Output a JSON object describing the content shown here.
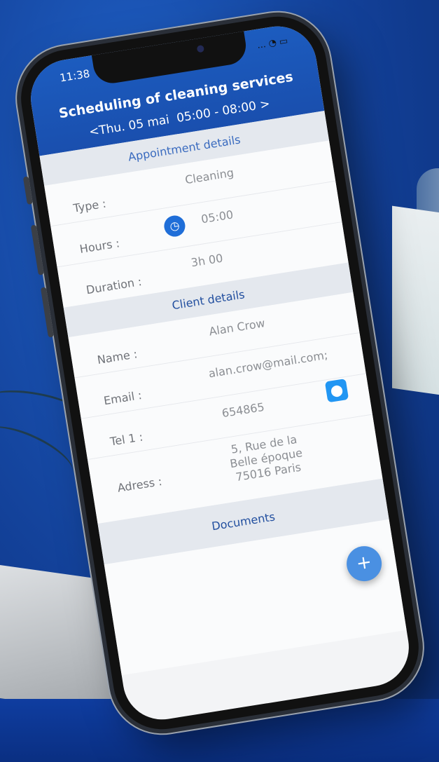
{
  "status_bar": {
    "time": "11:38",
    "signal": "...",
    "battery": "battery-icon"
  },
  "header": {
    "title": "Scheduling of cleaning services",
    "prev": "<",
    "date": "Thu. 05 mai",
    "time_range": "05:00 - 08:00",
    "next": ">"
  },
  "appointment": {
    "section_title": "Appointment details",
    "type_label": "Type :",
    "type_value": "Cleaning",
    "hours_label": "Hours :",
    "hours_value": "05:00",
    "duration_label": "Duration :",
    "duration_value": "3h 00"
  },
  "client": {
    "section_title": "Client details",
    "name_label": "Name :",
    "name_value": "Alan Crow",
    "email_label": "Email :",
    "email_value": "alan.crow@mail.com;",
    "tel_label": "Tel 1 :",
    "tel_value": "654865",
    "address_label": "Adress :",
    "address_line1": "5, Rue de la",
    "address_line2": "Belle époque",
    "address_line3": "75016 Paris"
  },
  "documents": {
    "section_title": "Documents",
    "add_button": "+"
  },
  "colors": {
    "primary": "#1c5cbf",
    "accent": "#4a90e2",
    "section_bg": "#e4e8ee"
  }
}
